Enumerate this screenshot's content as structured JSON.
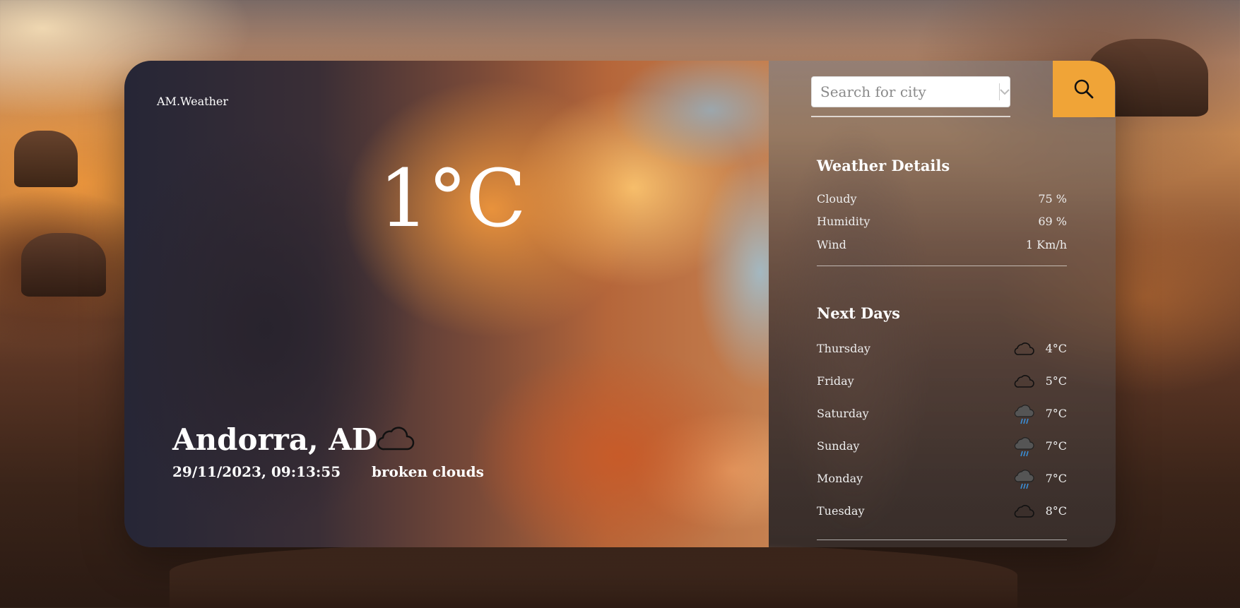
{
  "app": {
    "brand": "AM.Weather"
  },
  "current": {
    "temperature": "1°C",
    "location": "Andorra, AD",
    "datetime": "29/11/2023, 09:13:55",
    "condition": "broken clouds",
    "condition_icon": "cloud-icon"
  },
  "search": {
    "placeholder": "Search for city",
    "value": "",
    "button_icon": "search-icon"
  },
  "details": {
    "title": "Weather Details",
    "rows": [
      {
        "label": "Cloudy",
        "value": "75 %"
      },
      {
        "label": "Humidity",
        "value": "69 %"
      },
      {
        "label": "Wind",
        "value": "1 Km/h"
      }
    ]
  },
  "forecast": {
    "title": "Next Days",
    "days": [
      {
        "day": "Thursday",
        "icon": "cloud-icon",
        "temp": "4°C"
      },
      {
        "day": "Friday",
        "icon": "cloud-icon",
        "temp": "5°C"
      },
      {
        "day": "Saturday",
        "icon": "rain-icon",
        "temp": "7°C"
      },
      {
        "day": "Sunday",
        "icon": "rain-icon",
        "temp": "7°C"
      },
      {
        "day": "Monday",
        "icon": "rain-icon",
        "temp": "7°C"
      },
      {
        "day": "Tuesday",
        "icon": "cloud-icon",
        "temp": "8°C"
      }
    ]
  },
  "colors": {
    "accent": "#f0a437"
  }
}
